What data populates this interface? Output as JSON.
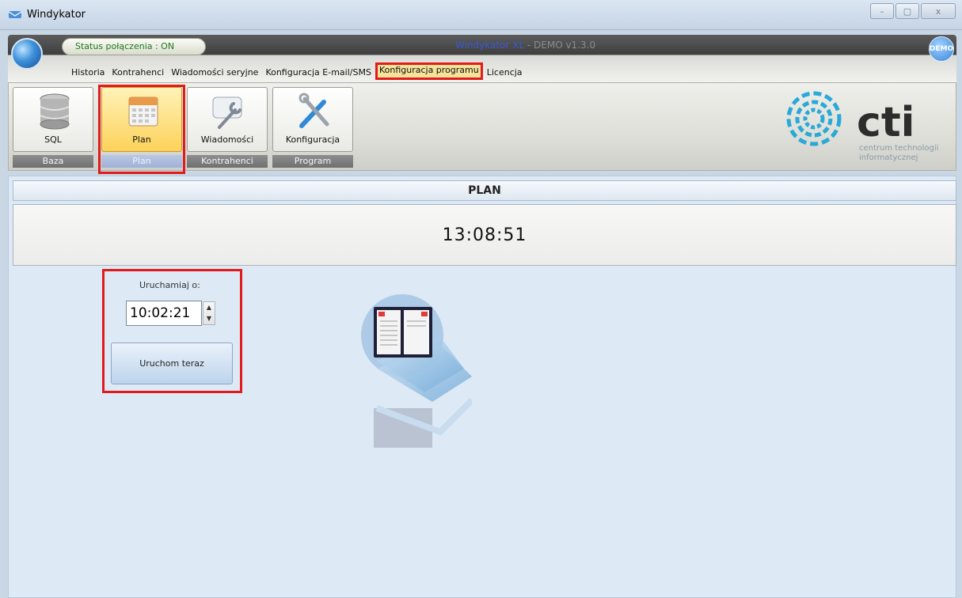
{
  "window": {
    "title": "Windykator",
    "controls": [
      "–",
      "▢",
      "x"
    ]
  },
  "header": {
    "status": "Status połączenia : ON",
    "app_name": "Windykator XL",
    "app_version": " - DEMO v1.3.0",
    "badge": "DEMO"
  },
  "menu": [
    {
      "label": "Historia"
    },
    {
      "label": "Kontrahenci"
    },
    {
      "label": "Wiadomości seryjne"
    },
    {
      "label": "Konfiguracja E-mail/SMS"
    },
    {
      "label": "Konfiguracja programu",
      "active": true
    },
    {
      "label": "Licencja"
    }
  ],
  "toolbar": {
    "buttons": [
      {
        "label": "SQL",
        "icon": "database-icon"
      },
      {
        "label": "Plan",
        "icon": "calendar-icon",
        "selected": true
      },
      {
        "label": "Wiadomości",
        "icon": "message-wrench-icon"
      },
      {
        "label": "Konfiguracja",
        "icon": "tools-icon"
      }
    ],
    "groups": [
      "Baza",
      "Plan",
      "Kontrahenci",
      "Program"
    ]
  },
  "logo": {
    "text": "cti",
    "tagline_1": "centrum technologii",
    "tagline_2": "informatycznej"
  },
  "plan": {
    "title": "PLAN",
    "clock": "13:08:51",
    "run_at_label": "Uruchamiaj o:",
    "run_at_value": "10:02:21",
    "run_now_label": "Uruchom teraz"
  },
  "colors": {
    "highlight": "#e11b1b",
    "selected_bg": "#fcd25a",
    "app_name": "#3a59d6"
  }
}
